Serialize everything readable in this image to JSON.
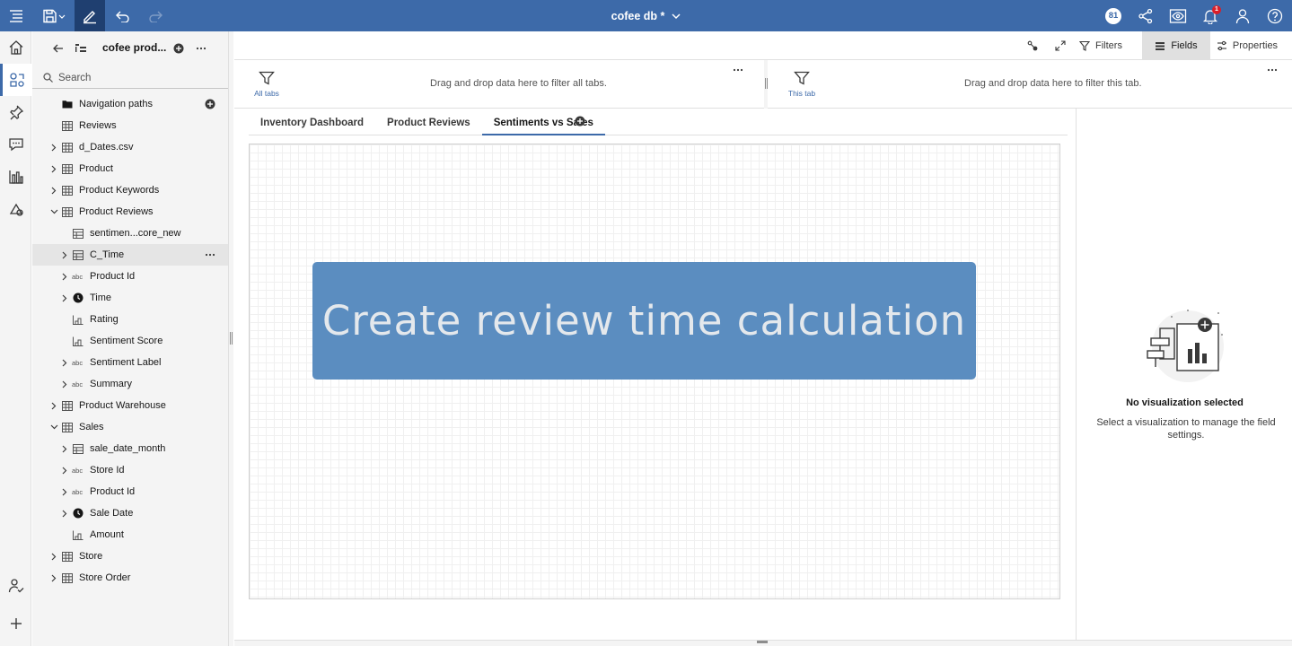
{
  "topbar": {
    "title": "cofee db *",
    "user_badge": "81",
    "notification_count": "1",
    "colors": {
      "background": "#3d6aa9",
      "active_tool": "#1f3f70"
    },
    "icons": [
      "menu-icon",
      "save-icon",
      "edit-icon",
      "undo-icon",
      "redo-icon",
      "share-icon",
      "preview-icon",
      "notifications-icon",
      "user-icon",
      "help-icon"
    ]
  },
  "rail": {
    "icons": [
      "home-icon",
      "data-sources-icon",
      "pin-icon",
      "comment-icon",
      "chart-icon",
      "assistant-icon",
      "collaborate-icon",
      "add-icon"
    ]
  },
  "data_panel": {
    "title": "cofee prod...",
    "search_placeholder": "Search",
    "tree": [
      {
        "label": "Navigation paths",
        "icon": "folder-icon",
        "expander": "none",
        "level": 1,
        "has_add": true
      },
      {
        "label": "Reviews",
        "icon": "table-icon",
        "expander": "none",
        "level": 1
      },
      {
        "label": "d_Dates.csv",
        "icon": "table-icon",
        "expander": "collapsed",
        "level": 1
      },
      {
        "label": "Product",
        "icon": "table-icon",
        "expander": "collapsed",
        "level": 1
      },
      {
        "label": "Product Keywords",
        "icon": "table-icon",
        "expander": "collapsed",
        "level": 1
      },
      {
        "label": "Product Reviews",
        "icon": "table-icon",
        "expander": "expanded",
        "level": 1
      },
      {
        "label": "sentimen...core_new",
        "icon": "grid-icon",
        "expander": "none",
        "level": 2
      },
      {
        "label": "C_Time",
        "icon": "grid-icon",
        "expander": "collapsed",
        "level": 2,
        "highlighted": true
      },
      {
        "label": "Product Id",
        "icon": "text-type-icon",
        "expander": "collapsed",
        "level": 2
      },
      {
        "label": "Time",
        "icon": "clock-icon",
        "expander": "collapsed",
        "level": 2
      },
      {
        "label": "Rating",
        "icon": "measure-icon",
        "expander": "none",
        "level": 2
      },
      {
        "label": "Sentiment Score",
        "icon": "measure-icon",
        "expander": "none",
        "level": 2
      },
      {
        "label": "Sentiment Label",
        "icon": "text-type-icon",
        "expander": "collapsed",
        "level": 2
      },
      {
        "label": "Summary",
        "icon": "text-type-icon",
        "expander": "collapsed",
        "level": 2
      },
      {
        "label": "Product Warehouse",
        "icon": "table-icon",
        "expander": "collapsed",
        "level": 1
      },
      {
        "label": "Sales",
        "icon": "table-icon",
        "expander": "expanded",
        "level": 1
      },
      {
        "label": "sale_date_month",
        "icon": "grid-icon",
        "expander": "collapsed",
        "level": 2
      },
      {
        "label": "Store Id",
        "icon": "text-type-icon",
        "expander": "collapsed",
        "level": 2
      },
      {
        "label": "Product Id",
        "icon": "text-type-icon",
        "expander": "collapsed",
        "level": 2
      },
      {
        "label": "Sale Date",
        "icon": "clock-icon",
        "expander": "collapsed",
        "level": 2
      },
      {
        "label": "Amount",
        "icon": "measure-icon",
        "expander": "none",
        "level": 2
      },
      {
        "label": "Store",
        "icon": "table-icon",
        "expander": "collapsed",
        "level": 1
      },
      {
        "label": "Store Order",
        "icon": "table-icon",
        "expander": "collapsed",
        "level": 1
      }
    ]
  },
  "toolbar": {
    "filters_label": "Filters",
    "fields_label": "Fields",
    "properties_label": "Properties"
  },
  "filters": {
    "all_tabs_label": "All tabs",
    "all_tabs_text": "Drag and drop data here to filter all tabs.",
    "this_tab_label": "This tab",
    "this_tab_text": "Drag and drop data here to filter this tab."
  },
  "tabs": [
    {
      "label": "Inventory Dashboard",
      "selected": false
    },
    {
      "label": "Product Reviews",
      "selected": false
    },
    {
      "label": "Sentiments vs Sales",
      "selected": true
    }
  ],
  "canvas": {
    "banner_text": "Create review time calculation",
    "banner_color": "#5b8dc0"
  },
  "fields_panel": {
    "empty_title": "No visualization selected",
    "empty_description": "Select a visualization to manage the field settings."
  }
}
